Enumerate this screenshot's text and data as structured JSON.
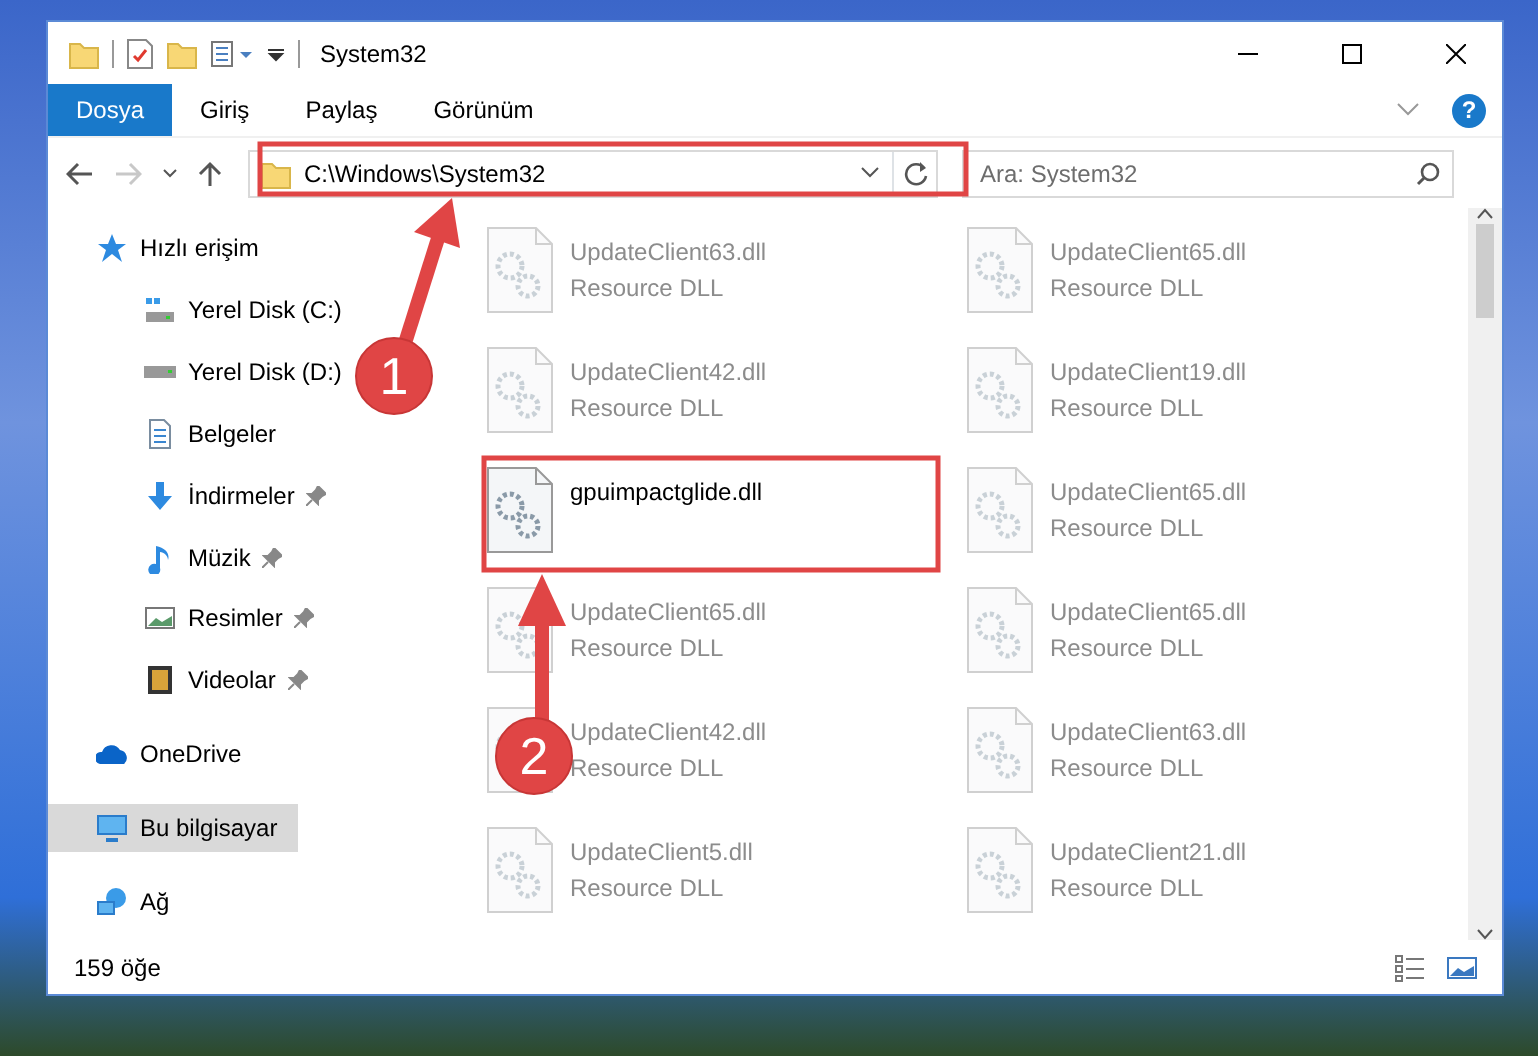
{
  "window": {
    "title": "System32"
  },
  "ribbon": {
    "tabs": [
      {
        "label": "Dosya",
        "kind": "file",
        "selected": false
      },
      {
        "label": "Giriş",
        "kind": "tab",
        "selected": false
      },
      {
        "label": "Paylaş",
        "kind": "tab",
        "selected": false
      },
      {
        "label": "Görünüm",
        "kind": "tab",
        "selected": false
      }
    ],
    "help": "?"
  },
  "address_bar": {
    "path": "C:\\Windows\\System32",
    "search_placeholder": "Ara: System32",
    "forward_disabled": true
  },
  "sidebar": {
    "items": [
      {
        "label": "Hızlı erişim",
        "kind": "star",
        "selected": false,
        "children": [
          {
            "label": "Yerel Disk (C:)",
            "kind": "drive-c",
            "pinned": false,
            "selected": false
          },
          {
            "label": "Yerel Disk (D:)",
            "kind": "drive",
            "pinned": false,
            "selected": false
          },
          {
            "label": "Belgeler",
            "kind": "document",
            "pinned": false,
            "selected": false
          },
          {
            "label": "İndirmeler",
            "kind": "download",
            "pinned": true,
            "selected": false
          },
          {
            "label": "Müzik",
            "kind": "music",
            "pinned": true,
            "selected": false
          },
          {
            "label": "Resimler",
            "kind": "pictures",
            "pinned": true,
            "selected": false
          },
          {
            "label": "Videolar",
            "kind": "video",
            "pinned": true,
            "selected": false
          }
        ]
      },
      {
        "label": "OneDrive",
        "kind": "cloud",
        "selected": false
      },
      {
        "label": "Bu bilgisayar",
        "kind": "computer",
        "selected": true
      },
      {
        "label": "Ağ",
        "kind": "network",
        "selected": false
      }
    ]
  },
  "files": [
    {
      "name": "UpdateClient63.dll",
      "type": "Resource DLL",
      "highlighted": false
    },
    {
      "name": "UpdateClient65.dll",
      "type": "Resource DLL",
      "highlighted": false
    },
    {
      "name": "UpdateClient42.dll",
      "type": "Resource DLL",
      "highlighted": false
    },
    {
      "name": "UpdateClient19.dll",
      "type": "Resource DLL",
      "highlighted": false
    },
    {
      "name": "gpuimpactglide.dll",
      "highlighted": true
    },
    {
      "name": "UpdateClient65.dll",
      "type": "Resource DLL",
      "highlighted": false
    },
    {
      "name": "UpdateClient65.dll",
      "type": "Resource DLL",
      "highlighted": false
    },
    {
      "name": "UpdateClient65.dll",
      "type": "Resource DLL",
      "highlighted": false
    },
    {
      "name": "UpdateClient42.dll",
      "type": "Resource DLL",
      "highlighted": false
    },
    {
      "name": "UpdateClient63.dll",
      "type": "Resource DLL",
      "highlighted": false
    },
    {
      "name": "UpdateClient5.dll",
      "type": "Resource DLL",
      "highlighted": false
    },
    {
      "name": "UpdateClient21.dll",
      "type": "Resource DLL",
      "highlighted": false
    }
  ],
  "status_bar": {
    "item_count": "159 öğe"
  },
  "annotations": [
    {
      "number": "1"
    },
    {
      "number": "2"
    }
  ]
}
